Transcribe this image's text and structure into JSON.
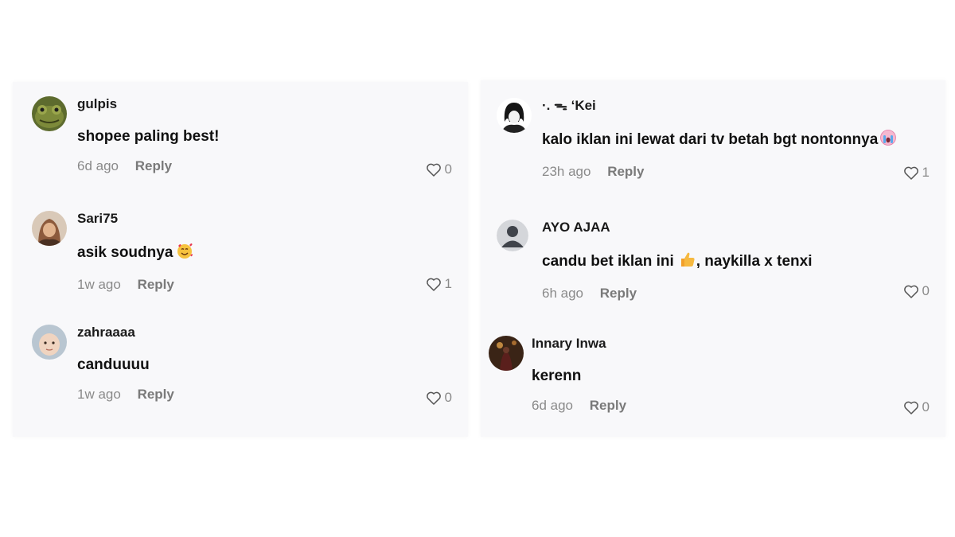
{
  "left_column": {
    "comments": [
      {
        "username": "gulpis",
        "text": "shopee paling best!",
        "emoji": "",
        "time": "6d ago",
        "reply_label": "Reply",
        "likes": "0",
        "avatar_icon": "frog-avatar-icon"
      },
      {
        "username": "Sari75",
        "text": "asik soudnya",
        "emoji": "smiling-face-with-hearts",
        "time": "1w ago",
        "reply_label": "Reply",
        "likes": "1",
        "avatar_icon": "woman-hijab-avatar-icon"
      },
      {
        "username": "zahraaaa",
        "text": "canduuuu",
        "emoji": "",
        "time": "1w ago",
        "reply_label": "Reply",
        "likes": "0",
        "avatar_icon": "baby-avatar-icon"
      }
    ]
  },
  "right_column": {
    "comments": [
      {
        "username": "·. ᯓ ‘Kei",
        "text": "kalo iklan ini lewat dari tv betah bgt nontonnya",
        "emoji": "crying-face",
        "time": "23h ago",
        "reply_label": "Reply",
        "likes": "1",
        "avatar_icon": "anime-character-avatar-icon"
      },
      {
        "username": "AYO AJAA",
        "text": "candu bet iklan ini",
        "text_after_emoji": ", naykilla x tenxi",
        "emoji": "thumbs-up",
        "time": "6h ago",
        "reply_label": "Reply",
        "likes": "0",
        "avatar_icon": "default-user-avatar-icon"
      },
      {
        "username": "Innary Inwa",
        "text": "kerenn",
        "emoji": "",
        "time": "6d ago",
        "reply_label": "Reply",
        "likes": "0",
        "avatar_icon": "photo-avatar-icon"
      }
    ]
  },
  "colors": {
    "panel_background": "#f8f8fa",
    "text_primary": "#111111",
    "text_muted": "#8a8a8a",
    "reply": "#7a7a7a"
  }
}
